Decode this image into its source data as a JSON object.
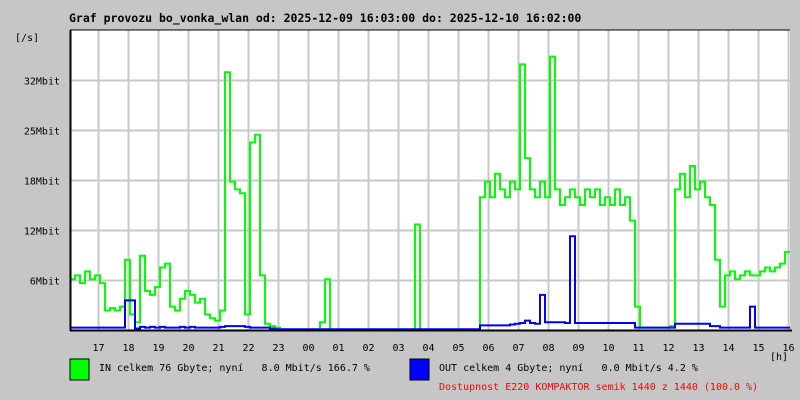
{
  "chart_data": {
    "type": "line",
    "title": "Graf provozu bo_vonka_wlan od: 2025-12-09 16:03:00 do: 2025-12-10 16:02:00",
    "ylabel": "[/s]",
    "xlabel": "[h]",
    "ylim_mbit": [
      0,
      38.4
    ],
    "y_ticks": [
      {
        "value": 6.4,
        "label": "6Mbit"
      },
      {
        "value": 12.8,
        "label": "12Mbit"
      },
      {
        "value": 19.2,
        "label": "18Mbit"
      },
      {
        "value": 25.6,
        "label": "25Mbit"
      },
      {
        "value": 32,
        "label": "32Mbit"
      }
    ],
    "x_ticks": [
      "17",
      "18",
      "19",
      "20",
      "21",
      "22",
      "23",
      "00",
      "01",
      "02",
      "03",
      "04",
      "05",
      "06",
      "07",
      "08",
      "09",
      "10",
      "11",
      "12",
      "13",
      "14",
      "15",
      "16"
    ],
    "x_start": "16:03",
    "sample_interval_min": 10,
    "grid": true,
    "series": [
      {
        "name": "IN",
        "color": "#00ff00",
        "values": [
          6.5,
          7,
          6,
          7.5,
          6.5,
          7,
          6,
          2.5,
          2.8,
          2.5,
          3,
          9,
          2,
          1,
          9.5,
          5,
          4.5,
          5.5,
          8,
          8.5,
          3,
          2.5,
          4,
          5,
          4.5,
          3.5,
          4,
          2,
          1.5,
          1.2,
          2.5,
          33,
          19,
          18,
          17.5,
          2,
          24,
          25,
          7,
          0.8,
          0.5,
          0.3,
          0,
          0,
          0,
          0,
          0,
          0,
          0,
          0,
          1,
          6.5,
          0,
          0,
          0,
          0,
          0,
          0,
          0,
          0,
          0,
          0,
          0,
          0,
          0,
          0,
          0,
          0,
          0,
          13.5,
          0,
          0,
          0,
          0,
          0,
          0,
          0,
          0,
          0,
          0,
          0,
          0,
          17,
          19,
          17,
          20,
          18,
          17,
          19,
          18,
          34,
          22,
          18,
          17,
          19,
          17,
          35,
          18,
          16,
          17,
          18,
          17,
          16,
          18,
          17,
          18,
          16,
          17,
          16,
          18,
          16,
          17,
          14,
          3,
          0.3,
          0.3,
          0.3,
          0.3,
          0.3,
          0.3,
          0.5,
          18,
          20,
          17,
          21,
          18,
          19,
          17,
          16,
          9,
          3,
          7,
          7.5,
          6.5,
          7,
          7.5,
          7,
          7,
          7.5,
          8,
          7.5,
          8,
          8.5,
          10
        ]
      },
      {
        "name": "OUT",
        "color": "#0000ff",
        "values": [
          0.3,
          0.3,
          0.3,
          0.3,
          0.3,
          0.3,
          0.3,
          0.3,
          0.3,
          0.3,
          0.3,
          3.8,
          3.8,
          0.2,
          0.4,
          0.3,
          0.4,
          0.3,
          0.4,
          0.3,
          0.3,
          0.3,
          0.4,
          0.3,
          0.4,
          0.3,
          0.3,
          0.3,
          0.3,
          0.3,
          0.4,
          0.5,
          0.5,
          0.5,
          0.5,
          0.4,
          0.3,
          0.3,
          0.3,
          0.3,
          0.2,
          0.1,
          0.1,
          0.1,
          0.1,
          0.1,
          0.1,
          0.1,
          0.1,
          0.1,
          0.1,
          0.1,
          0.1,
          0.1,
          0.1,
          0.1,
          0.1,
          0.1,
          0.1,
          0.1,
          0.1,
          0.1,
          0.1,
          0.1,
          0.1,
          0.1,
          0.1,
          0.1,
          0.1,
          0.1,
          0.1,
          0.1,
          0.1,
          0.1,
          0.1,
          0.1,
          0.1,
          0.1,
          0.1,
          0.1,
          0.1,
          0.1,
          0.6,
          0.6,
          0.6,
          0.6,
          0.6,
          0.6,
          0.7,
          0.8,
          0.9,
          1.2,
          0.9,
          0.8,
          4.5,
          1,
          1,
          1,
          1,
          0.9,
          12,
          0.9,
          0.9,
          0.9,
          0.9,
          0.9,
          0.9,
          0.9,
          0.9,
          0.9,
          0.9,
          0.9,
          0.9,
          0.3,
          0.3,
          0.3,
          0.3,
          0.3,
          0.3,
          0.3,
          0.3,
          0.8,
          0.8,
          0.8,
          0.8,
          0.8,
          0.8,
          0.8,
          0.5,
          0.5,
          0.3,
          0.3,
          0.3,
          0.3,
          0.3,
          0.3,
          3,
          0.3,
          0.3,
          0.3,
          0.3,
          0.3,
          0.3,
          0.3
        ]
      }
    ]
  },
  "legend": {
    "in_text": "IN celkem 76 Gbyte; nyní   8.0 Mbit/s 166.7 %",
    "out_text": "OUT celkem 4 Gbyte; nyní   0.0 Mbit/s 4.2 %",
    "availability": "Dostupnost E220 KOMPAKTOR semik 1440 z 1440 (100.0 %)",
    "in_color": "#00ff00",
    "out_color": "#0000ff",
    "availability_color": "#ff0000"
  }
}
